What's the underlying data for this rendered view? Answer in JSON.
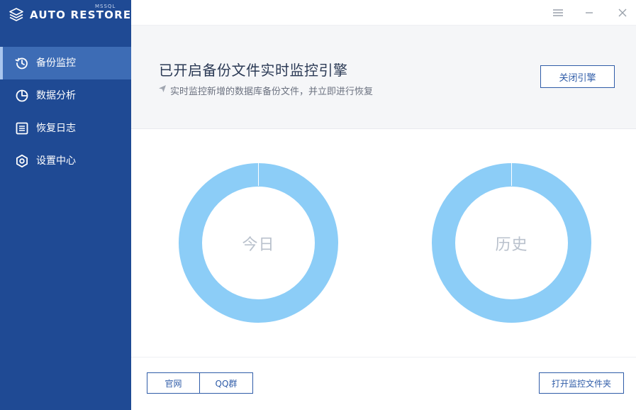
{
  "brand": {
    "name": "AUTO RESTORE",
    "sub": "MSSQL"
  },
  "sidebar": {
    "items": [
      {
        "label": "备份监控",
        "icon": "history-clock-icon",
        "active": true
      },
      {
        "label": "数据分析",
        "icon": "pie-chart-icon",
        "active": false
      },
      {
        "label": "恢复日志",
        "icon": "log-list-icon",
        "active": false
      },
      {
        "label": "设置中心",
        "icon": "settings-gear-icon",
        "active": false
      }
    ]
  },
  "window": {
    "menu_icon": "menu-icon",
    "minimize_icon": "minimize-icon",
    "close_icon": "close-icon"
  },
  "header": {
    "title": "已开启备份文件实时监控引擎",
    "description": "实时监控新增的数据库备份文件，并立即进行恢复",
    "close_engine_label": "关闭引擎"
  },
  "stats": {
    "today_label": "今日",
    "history_label": "历史"
  },
  "footer": {
    "website_label": "官网",
    "qq_group_label": "QQ群",
    "open_folder_label": "打开监控文件夹"
  },
  "colors": {
    "sidebar_bg": "#1f4a94",
    "sidebar_active": "#3d6cb5",
    "accent": "#2f5ca8",
    "ring": "#8ccdf7"
  }
}
